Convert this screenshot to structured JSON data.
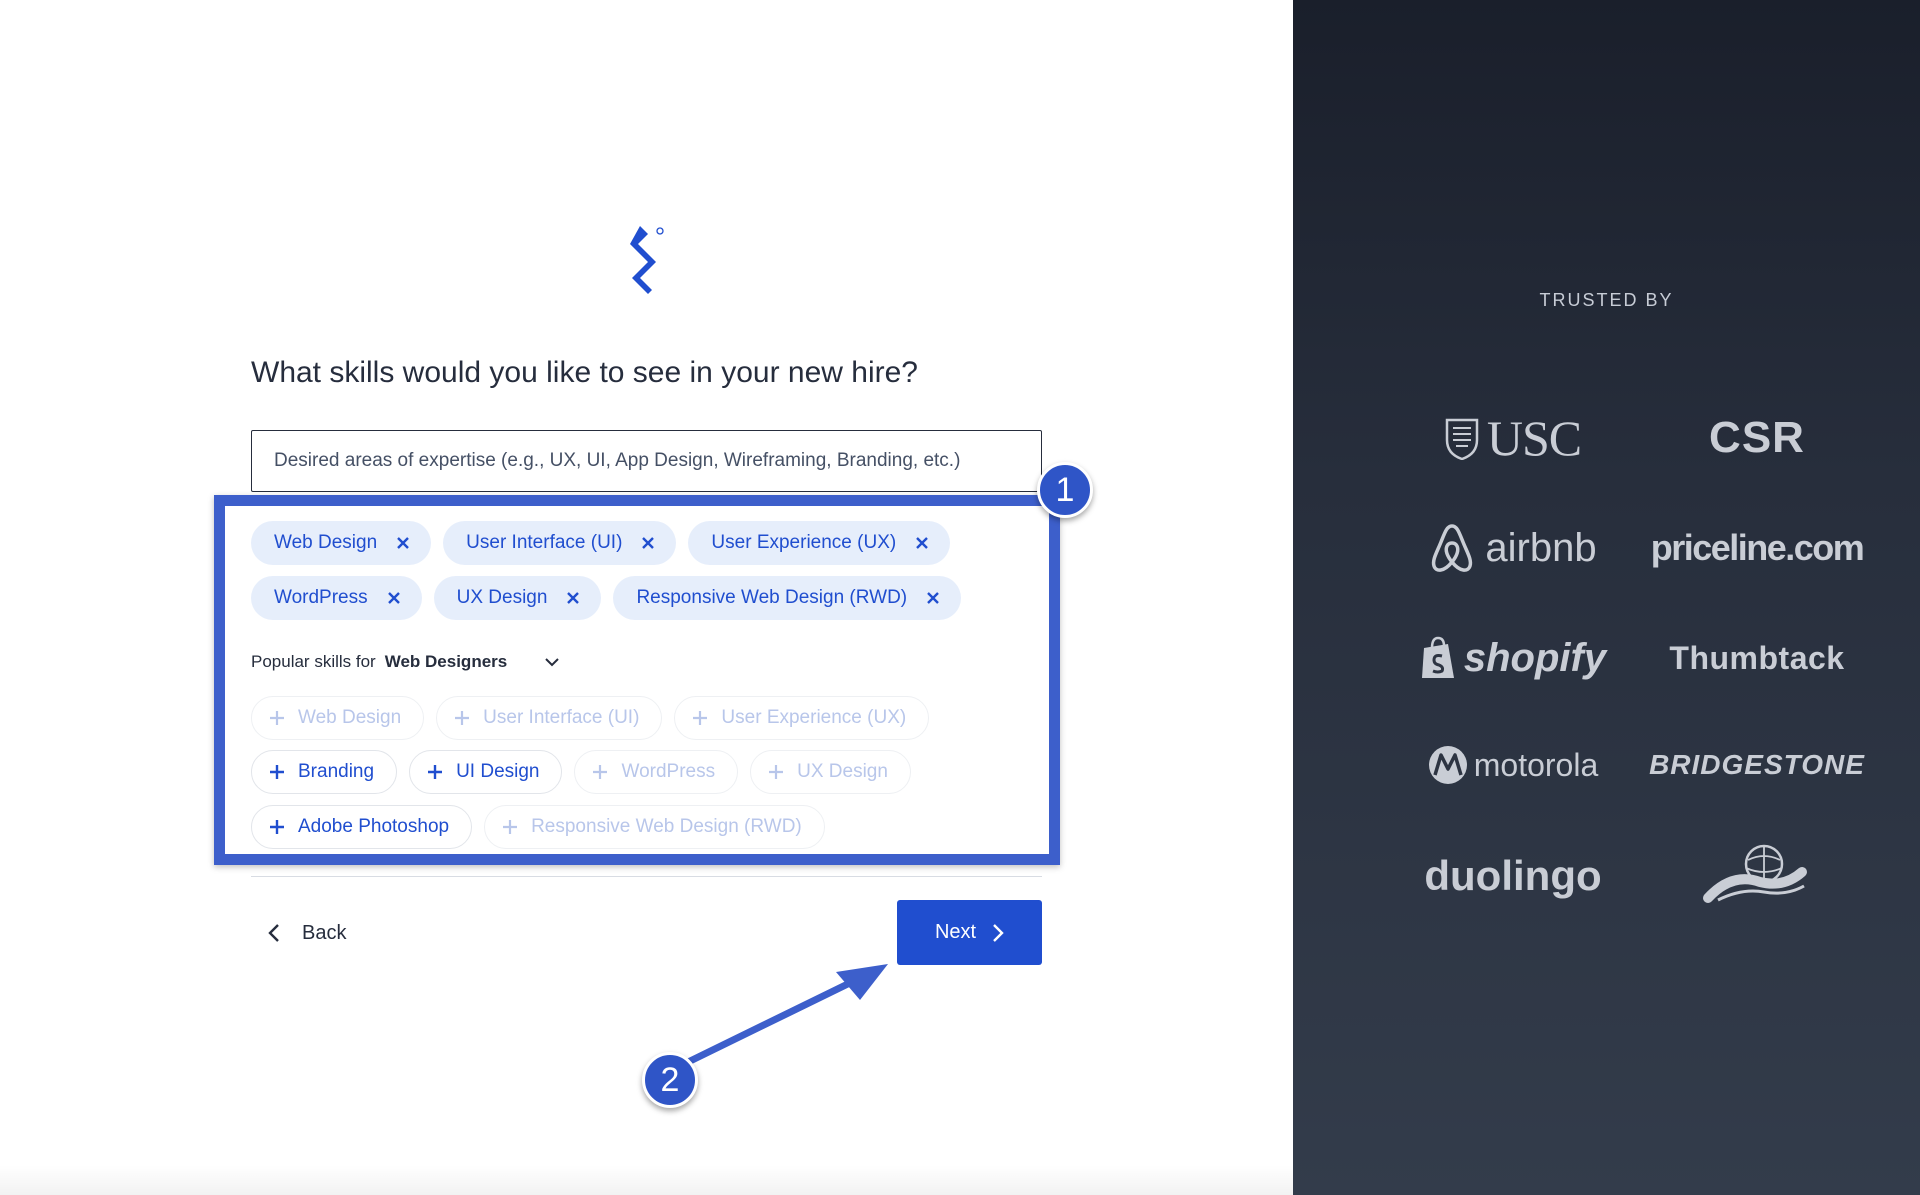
{
  "form": {
    "question": "What skills would you like to see in your new hire?",
    "input_placeholder": "Desired areas of expertise (e.g., UX, UI, App Design, Wireframing, Branding, etc.)",
    "selected_skills": [
      "Web Design",
      "User Interface (UI)",
      "User Experience (UX)",
      "WordPress",
      "UX Design",
      "Responsive Web Design (RWD)"
    ],
    "popular_label": "Popular skills for",
    "popular_role": "Web Designers",
    "suggested_skills": [
      {
        "label": "Web Design",
        "disabled": true
      },
      {
        "label": "User Interface (UI)",
        "disabled": true
      },
      {
        "label": "User Experience (UX)",
        "disabled": true
      },
      {
        "label": "Branding",
        "disabled": false
      },
      {
        "label": "UI Design",
        "disabled": false
      },
      {
        "label": "WordPress",
        "disabled": true
      },
      {
        "label": "UX Design",
        "disabled": true
      },
      {
        "label": "Adobe Photoshop",
        "disabled": false
      },
      {
        "label": "Responsive Web Design (RWD)",
        "disabled": true
      }
    ],
    "back_label": "Back",
    "next_label": "Next"
  },
  "annotations": {
    "badge_1": "1",
    "badge_2": "2"
  },
  "sidebar": {
    "trusted_by": "TRUSTED BY",
    "logos": {
      "usc": "USC",
      "csr": "CSR",
      "airbnb": "airbnb",
      "priceline": "priceline",
      "priceline_suffix": ".com",
      "shopify": "shopify",
      "thumbtack": "Thumbtack",
      "motorola": "motorola",
      "bridgestone": "BRIDGESTONE",
      "duolingo": "duolingo"
    }
  },
  "colors": {
    "brand_blue": "#204ecf",
    "chip_bg": "#e6eefb",
    "annotation_blue": "#3d5fcb",
    "sidebar_bg": "#272e3c"
  }
}
